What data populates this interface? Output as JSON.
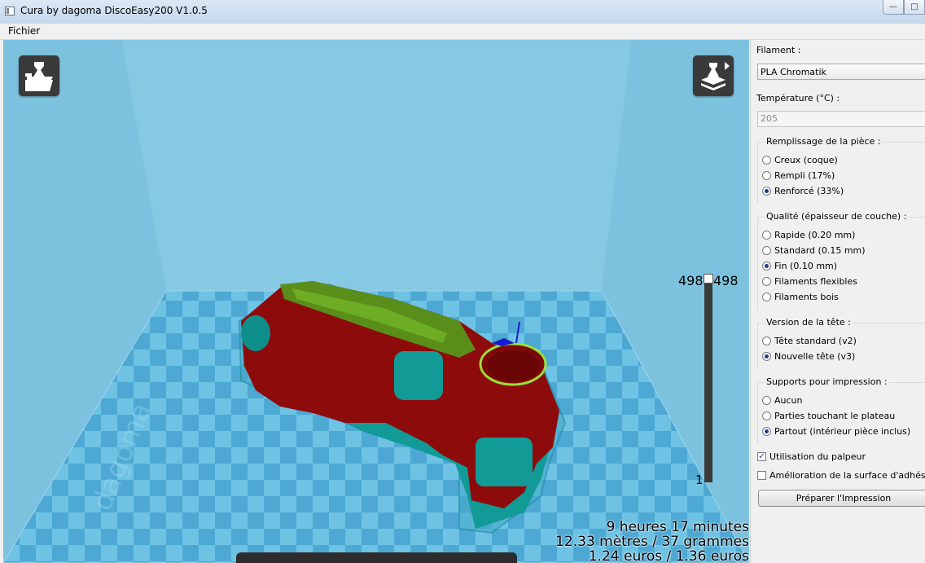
{
  "window": {
    "title": "Cura by dagoma DiscoEasy200 V1.0.5"
  },
  "menu": {
    "items": [
      "Fichier"
    ]
  },
  "viewport": {
    "layers": {
      "top_left": "498",
      "top_right": "498",
      "bottom": "1"
    },
    "print_info": {
      "time": "9 heures 17 minutes",
      "material": "12.33 mètres / 37 grammes",
      "cost": "1.24 euros / 1.36 euros"
    }
  },
  "panel": {
    "filament": {
      "label": "Filament :",
      "value": "PLA Chromatik"
    },
    "temperature": {
      "label": "Température (°C) :",
      "value": "205"
    },
    "infill": {
      "title": "Remplissage de la pièce :",
      "options": [
        "Creux (coque)",
        "Rempli (17%)",
        "Renforcé (33%)"
      ],
      "selected": 2
    },
    "quality": {
      "title": "Qualité (épaisseur de couche) :",
      "options": [
        "Rapide (0.20 mm)",
        "Standard (0.15 mm)",
        "Fin (0.10 mm)",
        "Filaments flexibles",
        "Filaments bois"
      ],
      "selected": 2
    },
    "head": {
      "title": "Version de la tête :",
      "options": [
        "Tête standard (v2)",
        "Nouvelle tête (v3)"
      ],
      "selected": 1
    },
    "supports": {
      "title": "Supports pour impression :",
      "options": [
        "Aucun",
        "Parties touchant le plateau",
        "Partout (intérieur pièce inclus)"
      ],
      "selected": 2
    },
    "checkboxes": [
      {
        "label": "Utilisation du palpeur",
        "checked": true
      },
      {
        "label": "Amélioration de la surface d'adhésion",
        "checked": false
      }
    ],
    "prepare_button": "Préparer l'Impression"
  }
}
